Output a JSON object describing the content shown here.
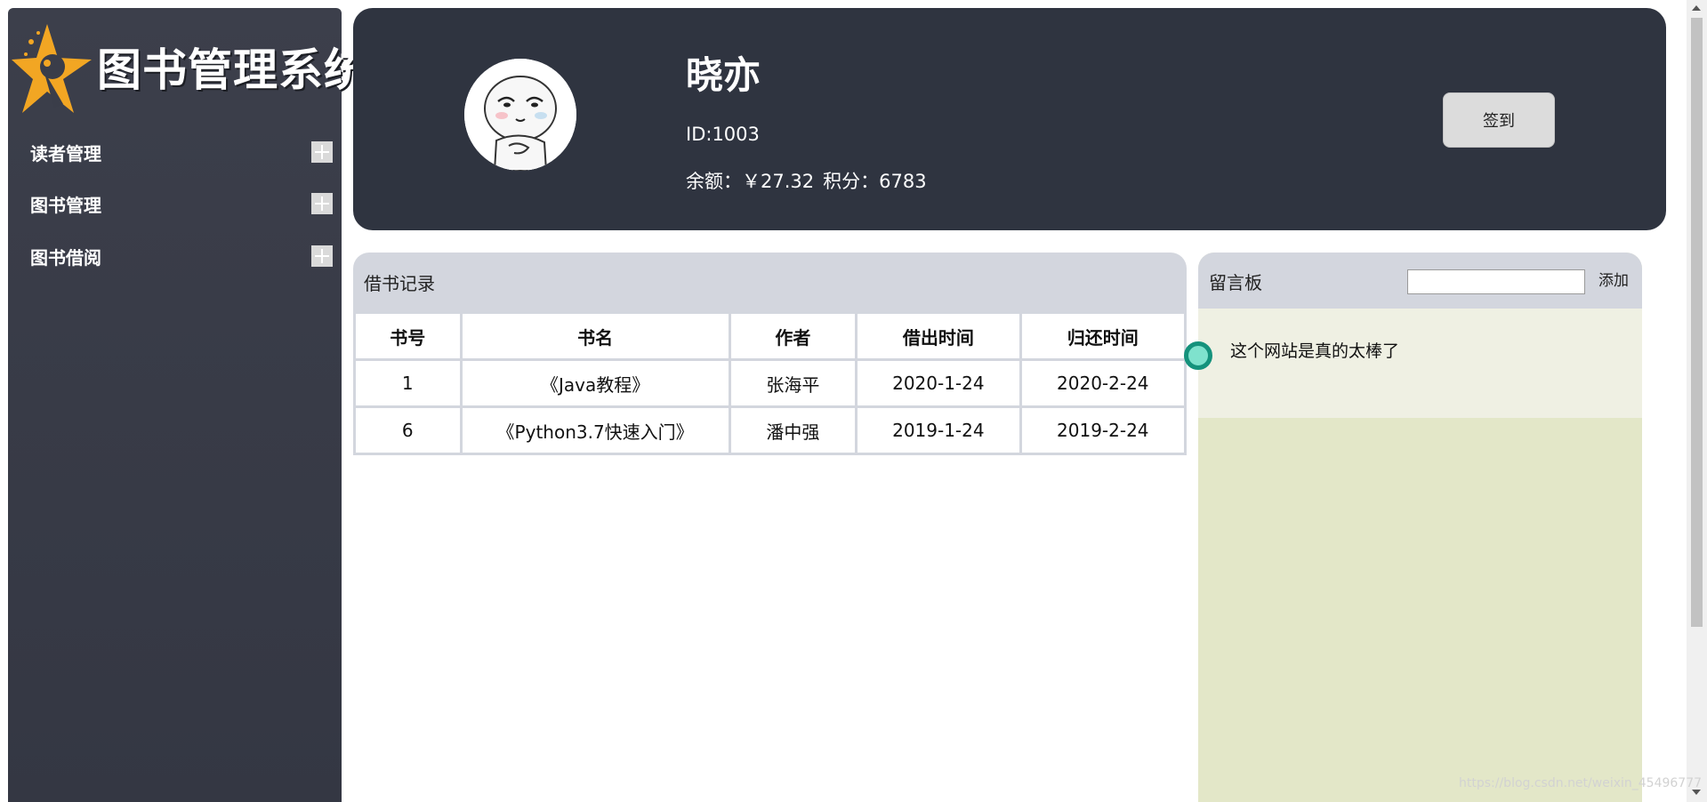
{
  "app": {
    "title": "图书管理系统"
  },
  "sidebar": {
    "items": [
      {
        "label": "读者管理",
        "icon": "plus-icon"
      },
      {
        "label": "图书管理",
        "icon": "plus-icon"
      },
      {
        "label": "图书借阅",
        "icon": "plus-icon"
      }
    ]
  },
  "profile": {
    "name": "晓亦",
    "id_text": "ID:1003",
    "balance_text": "余额：￥27.32",
    "points_text": "积分：6783",
    "checkin_label": "签到"
  },
  "records": {
    "title": "借书记录",
    "columns": [
      "书号",
      "书名",
      "作者",
      "借出时间",
      "归还时间"
    ],
    "rows": [
      [
        "1",
        "《Java教程》",
        "张海平",
        "2020-1-24",
        "2020-2-24"
      ],
      [
        "6",
        "《Python3.7快速入门》",
        "潘中强",
        "2019-1-24",
        "2019-2-24"
      ]
    ]
  },
  "board": {
    "title": "留言板",
    "input_value": "",
    "add_label": "添加",
    "messages": [
      "这个网站是真的太棒了"
    ]
  },
  "watermark": "https://blog.csdn.net/weixin_45496777",
  "colors": {
    "sidebar_bg": "#3a3d49",
    "header_bg": "#2f3440",
    "panel_header_bg": "#d3d6de",
    "board_bg": "#e3e7c8",
    "message_bg": "#eff0e3",
    "dot_fill": "#7fe2cd",
    "dot_ring": "#15927c",
    "logo_star": "#f2a623"
  }
}
